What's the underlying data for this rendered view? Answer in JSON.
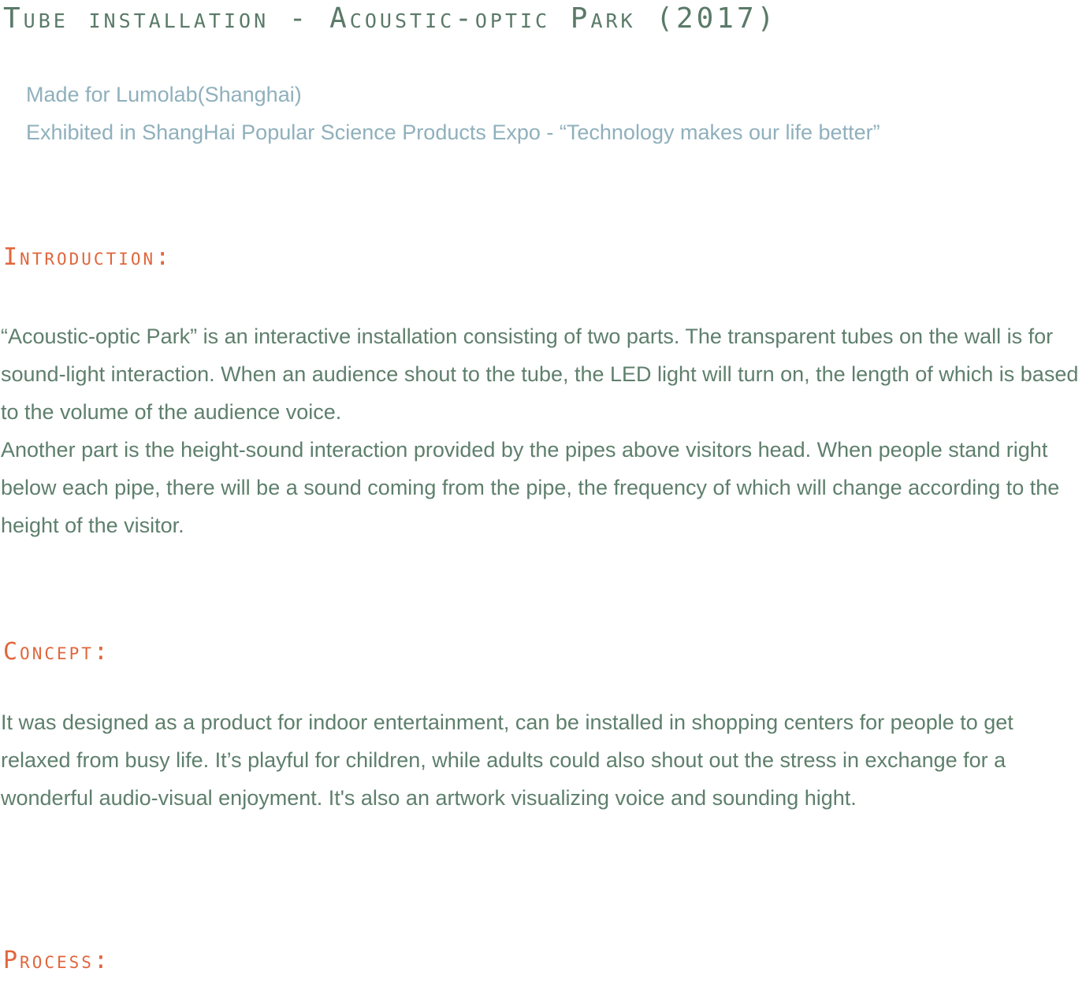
{
  "title": "Tube installation - Acoustic-optic Park  (2017)",
  "subtitle": {
    "made_for": "Made for Lumolab(Shanghai)",
    "exhibited": "Exhibited in ShangHai Popular Science Products Expo - “Technology makes our life better”"
  },
  "introduction": {
    "heading": "Introduction:",
    "paragraphs": [
      "“Acoustic-optic Park” is an interactive installation consisting of two parts. The transparent tubes on the wall is for sound-light interaction. When an audience shout to the tube, the LED light will turn on, the length of which is based to the volume of the audience voice.",
      "Another part is the height-sound interaction provided by the pipes above visitors head. When people stand right below each pipe, there will be a sound coming from the pipe, the frequency of which will change according to the height of the visitor."
    ]
  },
  "concept": {
    "heading": "Concept:",
    "paragraphs": [
      "It was designed as a product for indoor entertainment, can be installed in shopping centers for people to get relaxed from busy life. It’s playful for children, while adults could also shout out the stress in exchange for a wonderful audio-visual enjoyment. It's also an artwork visualizing voice and sounding hight."
    ]
  },
  "process": {
    "heading": "Process:"
  },
  "colors": {
    "title": "#5a7a68",
    "subtitle": "#8fb0bc",
    "heading": "#e0663c",
    "body": "#5e7f6c"
  }
}
